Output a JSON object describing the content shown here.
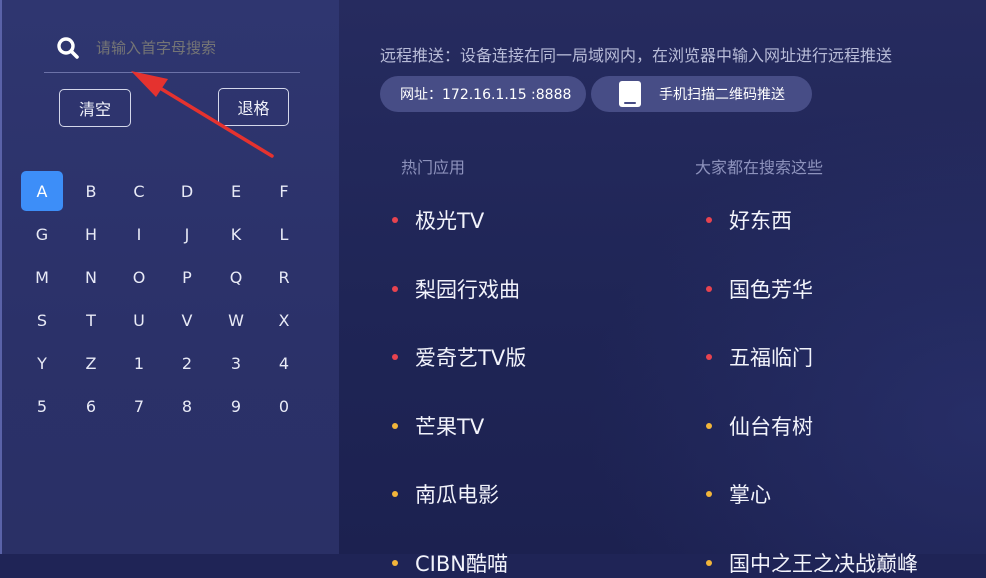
{
  "search": {
    "placeholder": "请输入首字母搜索"
  },
  "buttons": {
    "clear": "清空",
    "backspace": "退格"
  },
  "keyboard": [
    "A",
    "B",
    "C",
    "D",
    "E",
    "F",
    "G",
    "H",
    "I",
    "J",
    "K",
    "L",
    "M",
    "N",
    "O",
    "P",
    "Q",
    "R",
    "S",
    "T",
    "U",
    "V",
    "W",
    "X",
    "Y",
    "Z",
    "1",
    "2",
    "3",
    "4",
    "5",
    "6",
    "7",
    "8",
    "9",
    "0"
  ],
  "active_key": "A",
  "remote": {
    "tip": "远程推送：设备连接在同一局域网内，在浏览器中输入网址进行远程推送",
    "url_label": "网址：172.16.1.15 :8888",
    "qr_label": "手机扫描二维码推送"
  },
  "hot_apps": {
    "title": "热门应用",
    "items": [
      "极光TV",
      "梨园行戏曲",
      "爱奇艺TV版",
      "芒果TV",
      "南瓜电影",
      "CIBN酷喵"
    ]
  },
  "popular_searches": {
    "title": "大家都在搜索这些",
    "items": [
      "好东西",
      "国色芳华",
      "五福临门",
      "仙台有树",
      "掌心",
      "国中之王之决战巅峰"
    ]
  },
  "colors": {
    "active_key": "#3d8ef8",
    "dot_red": "#e8434f",
    "dot_yellow": "#f2b53a",
    "arrow": "#e5322f"
  }
}
